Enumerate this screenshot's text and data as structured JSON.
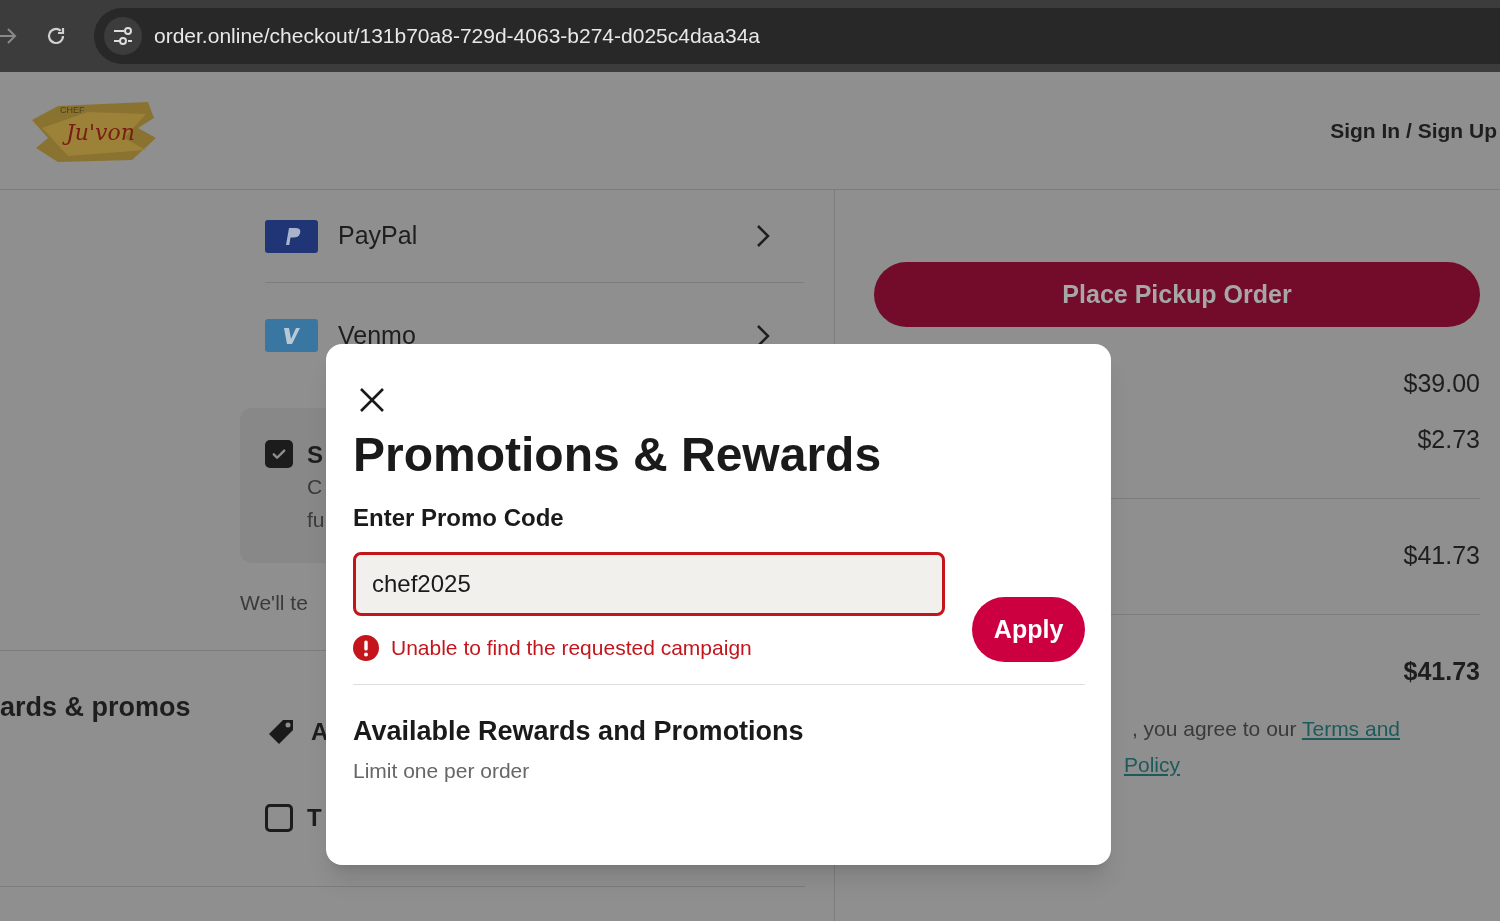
{
  "browser": {
    "url": "order.online/checkout/131b70a8-729d-4063-b274-d025c4daa34a"
  },
  "header": {
    "logo_small": "CHEF",
    "logo_name": "Ju'von",
    "sign_in": "Sign In / Sign Up"
  },
  "payment_methods": [
    {
      "kind": "paypal",
      "label": "PayPal"
    },
    {
      "kind": "venmo",
      "label": "Venmo"
    }
  ],
  "save_option": {
    "checked": true,
    "title": "S",
    "lines": [
      "C",
      "fu"
    ]
  },
  "text_notice": "We'll te",
  "promos_section": {
    "title": "ards & promos",
    "items": [
      {
        "kind": "tag",
        "label": "A"
      },
      {
        "kind": "checkbox",
        "checked": false,
        "label": "T"
      }
    ]
  },
  "summary": {
    "place_order": "Place Pickup Order",
    "groups": [
      [
        {
          "value": "$39.00",
          "bold": false
        },
        {
          "value": "$2.73",
          "bold": false
        }
      ],
      [
        {
          "value": "$41.73",
          "bold": false
        }
      ],
      [
        {
          "value": "$41.73",
          "bold": true
        }
      ]
    ],
    "terms_prefix": ", you agree to our",
    "terms_link": "Terms and",
    "policy_link": "Policy"
  },
  "modal": {
    "title": "Promotions & Rewards",
    "promo_field": {
      "label": "Enter Promo Code",
      "value": "chef2025",
      "error": "Unable to find the requested campaign"
    },
    "apply": "Apply",
    "available": {
      "title": "Available Rewards and Promotions",
      "subtitle": "Limit one per order"
    }
  }
}
